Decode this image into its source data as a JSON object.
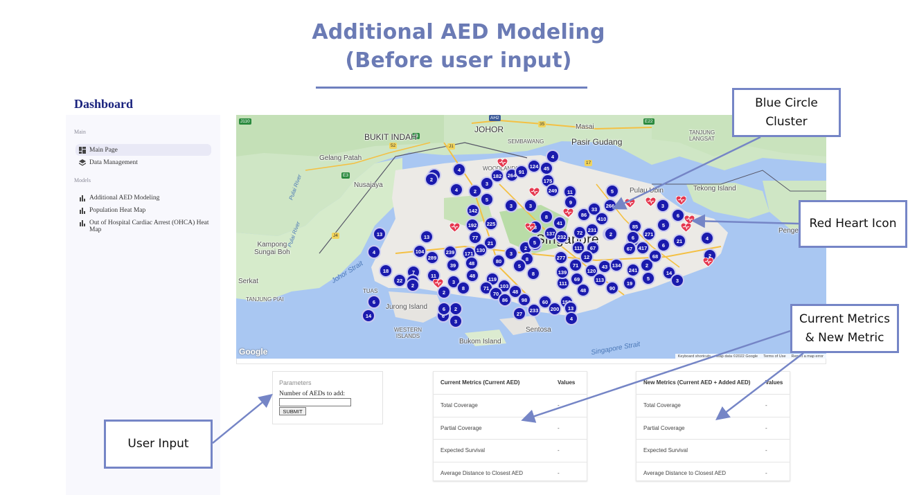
{
  "slide": {
    "title_line1": "Additional AED Modeling",
    "title_line2": "(Before user input)"
  },
  "dashboard": {
    "title": "Dashboard",
    "section_main": "Main",
    "main_items": [
      {
        "label": "Main Page",
        "icon": "dashboard-icon",
        "active": true
      },
      {
        "label": "Data Management",
        "icon": "layers-icon",
        "active": false
      }
    ],
    "section_models": "Models",
    "model_items": [
      {
        "label": "Additional AED Modeling",
        "icon": "bar-chart-icon"
      },
      {
        "label": "Population Heat Map",
        "icon": "bar-chart-icon"
      },
      {
        "label": "Out of Hospital Cardiac Arrest (OHCA) Heat Map",
        "icon": "bar-chart-icon"
      }
    ]
  },
  "map": {
    "labels": {
      "johor": "JOHOR",
      "bukit_indah": "BUKIT INDAH",
      "masai": "Masai",
      "pasir_gudang": "Pasir Gudang",
      "tanjung_langsat": "TANJUNG\nLANGSAT",
      "gelang_patah": "Gelang Patah",
      "nusajaya": "Nusajaya",
      "sembawang": "SEMBAWANG",
      "woodlands": "WOODLANDS",
      "pulau_ubin": "Pulau Ubin",
      "tekong": "Tekong Island",
      "pengerang": "Pengerang",
      "kampong": "Kampong\nSungai Boh",
      "serkat": "Serkat",
      "tanjung_piai": "TANJUNG PIAI",
      "tuas": "TUAS",
      "jurong_island": "Jurong Island",
      "western_islands": "WESTERN\nISLANDS",
      "bukom": "Bukom Island",
      "sentosa": "Sentosa",
      "singapore": "Singapore",
      "johor_strait": "Johor Strait",
      "singapore_strait": "Singapore Strait",
      "pulai_river": "Pulai River",
      "pulai_river2": "Pulai River"
    },
    "road_badges": [
      "J110",
      "AH2",
      "35",
      "E22",
      "J3",
      "52",
      "J1",
      "E3",
      "17",
      "J4"
    ],
    "clusters": [
      "3",
      "4",
      "4",
      "2",
      "3",
      "5",
      "182",
      "264",
      "91",
      "124",
      "45",
      "175",
      "249",
      "4",
      "3",
      "11",
      "9",
      "3",
      "142",
      "225",
      "192",
      "13",
      "77",
      "21",
      "104",
      "289",
      "239",
      "171",
      "130",
      "48",
      "39",
      "80",
      "3",
      "2",
      "8",
      "6",
      "7",
      "11",
      "3",
      "48",
      "8",
      "2",
      "18",
      "22",
      "2",
      "119",
      "71",
      "103",
      "70",
      "48",
      "86",
      "98",
      "60",
      "156",
      "200",
      "233",
      "13",
      "4",
      "27",
      "111",
      "5",
      "137",
      "232",
      "72",
      "231",
      "67",
      "12",
      "3",
      "111",
      "277",
      "71",
      "139",
      "69",
      "120",
      "43",
      "134",
      "48",
      "113",
      "90",
      "2",
      "6",
      "86",
      "33",
      "266",
      "410",
      "41",
      "8",
      "5",
      "8",
      "85",
      "271",
      "3",
      "6",
      "5",
      "67",
      "417",
      "6",
      "241",
      "2",
      "19",
      "5",
      "14",
      "3",
      "21",
      "4",
      "2",
      "68",
      "5",
      "3",
      "6",
      "2",
      "6",
      "2",
      "3",
      "6",
      "14",
      "4",
      "13",
      "2",
      "6",
      "8"
    ],
    "google_label": "Google",
    "attribution": [
      "Keyboard shortcuts",
      "Map data ©2022 Google",
      "Terms of Use",
      "Report a map error"
    ]
  },
  "parameters": {
    "header": "Parameters",
    "label": "Number of AEDs to add:",
    "input_value": "",
    "submit_label": "SUBMIT"
  },
  "current_metrics": {
    "col1": "Current Metrics (Current AED)",
    "col2": "Values",
    "rows": [
      {
        "metric": "Total Coverage",
        "value": "-"
      },
      {
        "metric": "Partial Coverage",
        "value": "-"
      },
      {
        "metric": "Expected Survival",
        "value": "-"
      },
      {
        "metric": "Average Distance to Closest AED",
        "value": "-"
      }
    ]
  },
  "new_metrics": {
    "col1": "New Metrics (Current AED + Added AED)",
    "col2": "Values",
    "rows": [
      {
        "metric": "Total Coverage",
        "value": "-"
      },
      {
        "metric": "Partial Coverage",
        "value": "-"
      },
      {
        "metric": "Expected Survival",
        "value": "-"
      },
      {
        "metric": "Average Distance to Closest AED",
        "value": "-"
      }
    ]
  },
  "callouts": {
    "blue_circle": "Blue Circle\nCluster",
    "red_heart": "Red Heart Icon",
    "metrics": "Current Metrics\n& New Metric",
    "user_input": "User Input"
  },
  "colors": {
    "title": "#6b7bb5",
    "callout_border": "#7585c6",
    "cluster": "#1a1aad",
    "heart": "#e53950",
    "dashboard_title": "#1a237e"
  }
}
